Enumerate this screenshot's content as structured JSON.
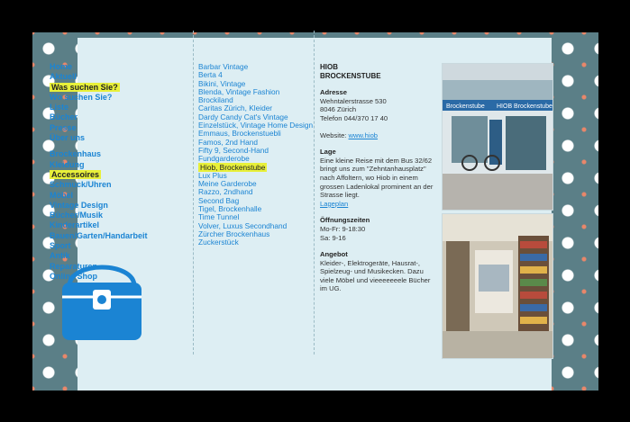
{
  "nav": {
    "top": [
      "Home",
      "Aktuell",
      "Was suchen Sie?",
      "Wo suchen Sie?",
      "Liste",
      "Bücher",
      "Presse",
      "Über uns"
    ],
    "categories": [
      "Brockenhaus",
      "Kleidung",
      "Accessoires",
      "Schmuck/Uhren",
      "Möbel",
      "Vintage Design",
      "Bücher/Musik",
      "Kinderartikel",
      "Bauen/Garten/Handarbeit",
      "Sport",
      "Antik",
      "Reparaturen",
      "Online Shop"
    ]
  },
  "shops": [
    "Barbar Vintage",
    "Berta 4",
    "Bikini, Vintage",
    "Blenda, Vintage Fashion",
    "Brockiland",
    "Caritas Zürich, Kleider",
    "Dardy Candy Cat's Vintage",
    "Einzelstück, Vintage Home Design",
    "Emmaus, Brockenstuebli",
    "Famos, 2nd Hand",
    "Fifty 9, Second-Hand",
    "Fundgarderobe",
    "Hiob, Brockenstube",
    "Lux Plus",
    "Meine Garderobe",
    "Razzo, 2ndhand",
    "Second Bag",
    "Tigel, Brockenhalle",
    "Time Tunnel",
    "Volver, Luxus Secondhand",
    "Zürcher Brockenhaus",
    "Zuckerstück"
  ],
  "detail": {
    "title_line1": "HIOB",
    "title_line2": "BROCKENSTUBE",
    "address_heading": "Adresse",
    "address_line1": "Wehntalerstrasse 530",
    "address_line2": "8046 Zürich",
    "phone": "Telefon 044/370 17 40",
    "website_label": "Website:",
    "website_link": "www.hiob",
    "lage_heading": "Lage",
    "lage_text": "Eine kleine Reise mit dem Bus 32/62 bringt uns zum \"Zehntanhausplatz\" nach Affoltern, wo Hiob in einem grossen Ladenlokal prominent an der Strasse liegt.",
    "lageplan_link": "Lageplan",
    "hours_heading": "Öffnungszeiten",
    "hours_line1": "Mo-Fr: 9-18:30",
    "hours_line2": "Sa: 9-16",
    "angebot_heading": "Angebot",
    "angebot_text": "Kleider-, Elektrogeräte, Hausrat-, Spielzeug- und Musikecken. Dazu viele Möbel und vieeeeeeele Bücher im UG."
  },
  "photos": {
    "storefront_sign": "Brockenstube",
    "storefront_sign2": "HIOB Brockenstube"
  },
  "colors": {
    "link": "#1b84d3",
    "highlight": "#e8f03a",
    "panel": "#ddeef3",
    "pattern": "#5b7f87"
  },
  "icons": {
    "bag": "handbag-icon"
  }
}
